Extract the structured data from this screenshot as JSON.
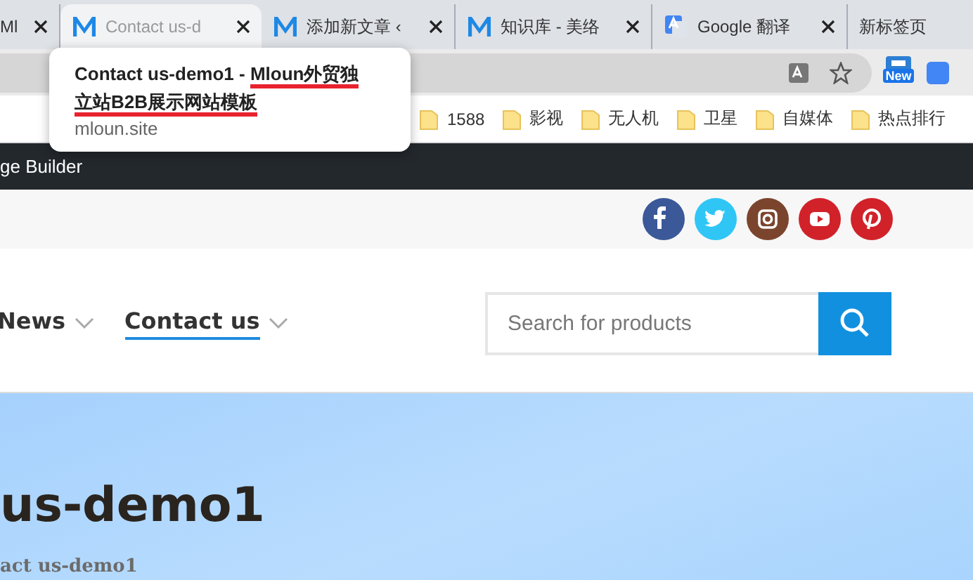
{
  "tabs": [
    {
      "label": "Ml",
      "kind": "plain",
      "selected": false,
      "closable": true
    },
    {
      "label": "Contact us-d",
      "kind": "site",
      "selected": true,
      "closable": true
    },
    {
      "label": "添加新文章 ‹",
      "kind": "site",
      "selected": false,
      "closable": true
    },
    {
      "label": "知识库 - 美络",
      "kind": "site",
      "selected": false,
      "closable": true
    },
    {
      "label": "Google 翻译",
      "kind": "translator",
      "selected": false,
      "closable": true
    },
    {
      "label": "新标签页",
      "kind": "plain",
      "selected": false,
      "closable": false
    }
  ],
  "toolbar": {
    "extension_badge": "New"
  },
  "bookmarks": [
    "1588",
    "影视",
    "无人机",
    "卫星",
    "自媒体",
    "热点排行"
  ],
  "admin_bar": {
    "label": "ge Builder"
  },
  "social": [
    {
      "kind": "facebook",
      "color": "#3b5998"
    },
    {
      "kind": "twitter",
      "color": "#2fc6f6"
    },
    {
      "kind": "instagram",
      "color": "#7b452d"
    },
    {
      "kind": "youtube",
      "color": "#d1222a"
    },
    {
      "kind": "pinterest",
      "color": "#d1222a"
    }
  ],
  "nav": [
    {
      "label": "News",
      "selected": false,
      "dropdown": true
    },
    {
      "label": "Contact us",
      "selected": true,
      "dropdown": true
    }
  ],
  "search": {
    "placeholder": "Search for products"
  },
  "hero": {
    "title": "us-demo1",
    "breadcrumb": "act us-demo1"
  },
  "tooltip": {
    "title_parts": [
      {
        "text": "Contact us-demo1 - ",
        "underlined": false
      },
      {
        "text": "Mloun外贸独立站B2B展示网站模板",
        "underlined": true
      }
    ],
    "url": "mloun.site"
  }
}
